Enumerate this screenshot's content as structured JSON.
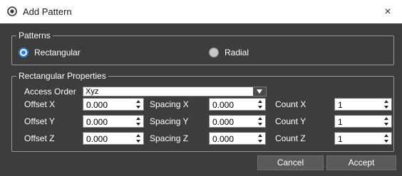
{
  "window": {
    "title": "Add Pattern",
    "close_glyph": "×",
    "icon": "app-target-icon"
  },
  "patterns": {
    "legend": "Patterns",
    "options": [
      {
        "label": "Rectangular",
        "checked": true
      },
      {
        "label": "Radial",
        "checked": false
      }
    ]
  },
  "rect": {
    "legend": "Rectangular Properties",
    "access_order": {
      "label": "Access Order",
      "value": "Xyz"
    },
    "offset_x": {
      "label": "Offset X",
      "value": "0.000"
    },
    "offset_y": {
      "label": "Offset Y",
      "value": "0.000"
    },
    "offset_z": {
      "label": "Offset Z",
      "value": "0.000"
    },
    "spacing_x": {
      "label": "Spacing X",
      "value": "0.000"
    },
    "spacing_y": {
      "label": "Spacing Y",
      "value": "0.000"
    },
    "spacing_z": {
      "label": "Spacing Z",
      "value": "0.000"
    },
    "count_x": {
      "label": "Count X",
      "value": "1"
    },
    "count_y": {
      "label": "Count Y",
      "value": "1"
    },
    "count_z": {
      "label": "Count Z",
      "value": "1"
    }
  },
  "buttons": {
    "cancel": "Cancel",
    "accept": "Accept"
  },
  "colors": {
    "background": "#3d3d3d",
    "accent": "#2f7fd8",
    "titlebar": "#ffffff"
  }
}
